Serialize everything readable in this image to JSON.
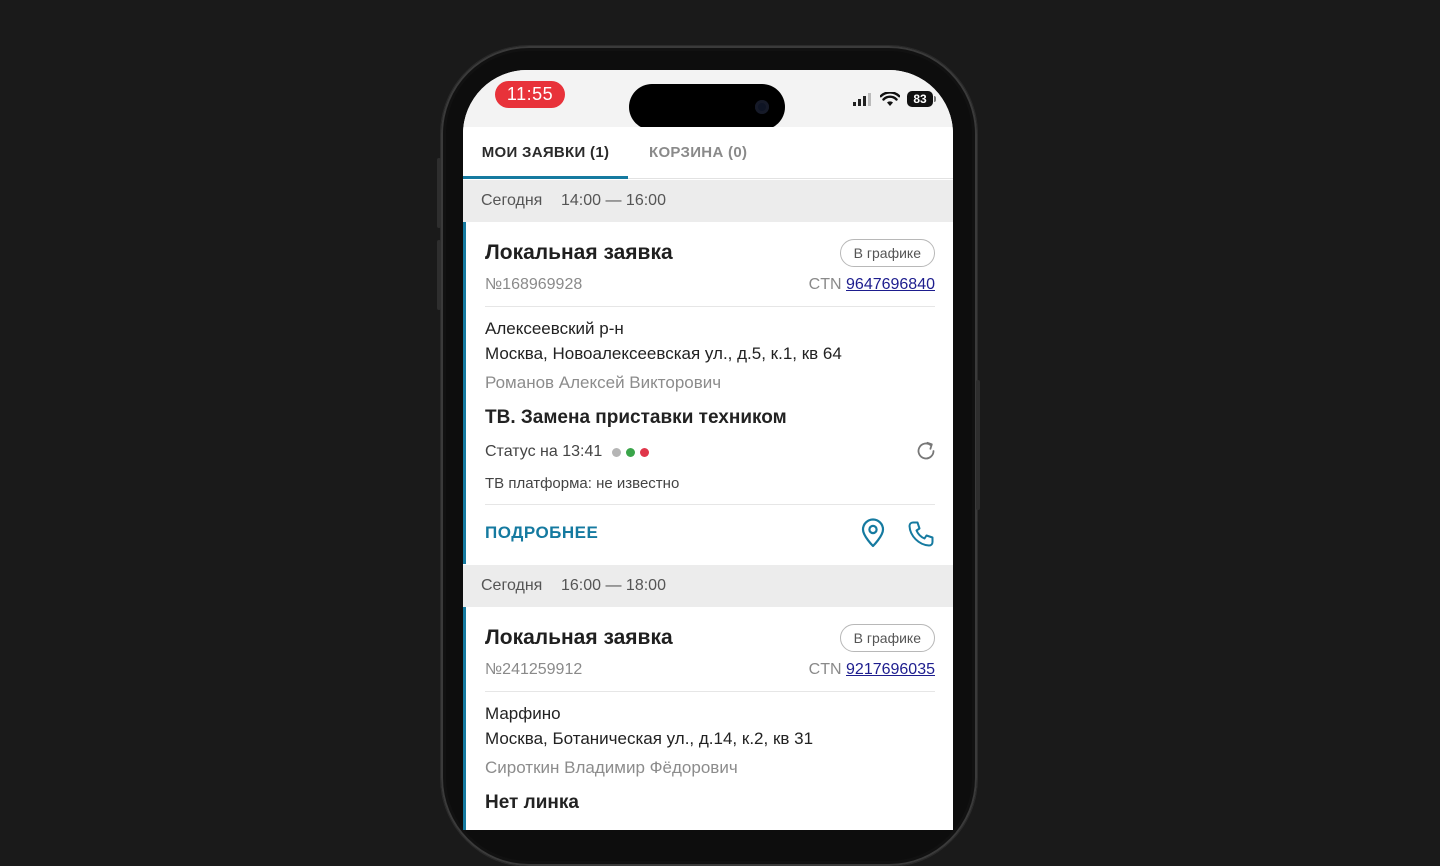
{
  "status_bar": {
    "time": "11:55",
    "battery": "83"
  },
  "tabs": [
    {
      "label": "МОИ ЗАЯВКИ (1)"
    },
    {
      "label": "КОРЗИНА (0)"
    }
  ],
  "sections": [
    {
      "day": "Сегодня",
      "range": "14:00 — 16:00",
      "card": {
        "title": "Локальная заявка",
        "badge": "В графике",
        "number": "№168969928",
        "ctn_label": "CTN",
        "ctn_value": "9647696840",
        "district": "Алексеевский р-н",
        "address": "Москва, Новоалексеевская ул., д.5, к.1, кв 64",
        "client": "Романов Алексей Викторович",
        "service": "ТВ. Замена приставки техником",
        "status": "Статус на 13:41",
        "status_colors": [
          "#b5b5b5",
          "#3aa54a",
          "#e0364a"
        ],
        "platform": "ТВ платформа: не известно",
        "more": "ПОДРОБНЕЕ"
      }
    },
    {
      "day": "Сегодня",
      "range": "16:00 — 18:00",
      "card": {
        "title": "Локальная заявка",
        "badge": "В графике",
        "number": "№241259912",
        "ctn_label": "CTN",
        "ctn_value": "9217696035",
        "district": "Марфино",
        "address": "Москва, Ботаническая ул., д.14, к.2, кв 31",
        "client": "Сироткин Владимир Фёдорович",
        "service": "Нет линка"
      }
    }
  ],
  "colors": {
    "accent": "#157aa0",
    "time_pill": "#e8323a",
    "link": "#1d1d8e"
  }
}
